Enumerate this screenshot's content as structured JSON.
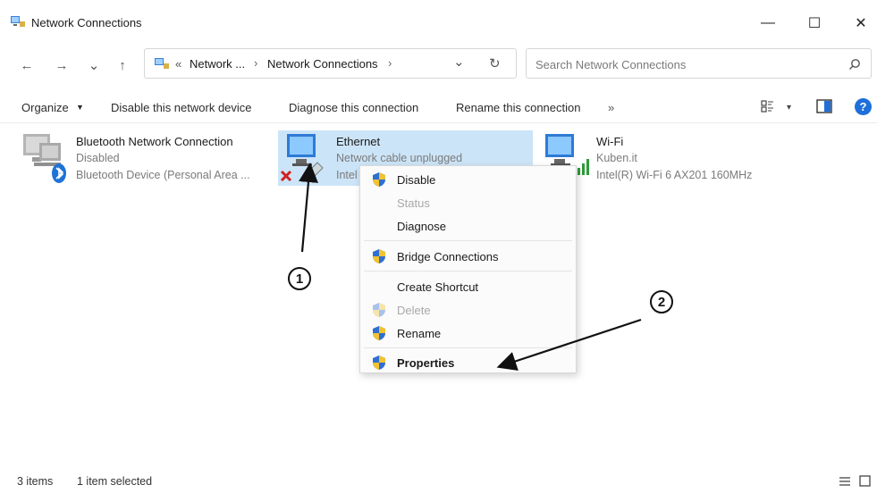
{
  "window": {
    "title": "Network Connections",
    "minimize": "—",
    "maximize": "☐",
    "close": "✕"
  },
  "nav": {
    "back": "←",
    "forward": "→",
    "recent": "⌄",
    "up": "↑",
    "breadcrumb_overflow": "«",
    "breadcrumb_1": "Network ...",
    "breadcrumb_sep": "›",
    "breadcrumb_2": "Network Connections",
    "breadcrumb_sep2": "›",
    "dropdown": "⌄",
    "refresh": "↻",
    "search_placeholder": "Search Network Connections"
  },
  "toolbar": {
    "organize": "Organize",
    "disable": "Disable this network device",
    "diagnose": "Diagnose this connection",
    "rename": "Rename this connection",
    "more": "»",
    "view_caret": "▾",
    "help": "?"
  },
  "connections": [
    {
      "name": "Bluetooth Network Connection",
      "status": "Disabled",
      "device": "Bluetooth Device (Personal Area ..."
    },
    {
      "name": "Ethernet",
      "status": "Network cable unplugged",
      "device": "Intel"
    },
    {
      "name": "Wi-Fi",
      "status": "Kuben.it",
      "device": "Intel(R) Wi-Fi 6 AX201 160MHz"
    }
  ],
  "context_menu": {
    "disable": "Disable",
    "status": "Status",
    "diagnose": "Diagnose",
    "bridge": "Bridge Connections",
    "shortcut": "Create Shortcut",
    "delete": "Delete",
    "rename": "Rename",
    "properties": "Properties"
  },
  "annotations": {
    "one": "1",
    "two": "2"
  },
  "statusbar": {
    "count": "3 items",
    "selected": "1 item selected"
  },
  "colors": {
    "selection": "#cce4f7",
    "accent": "#0067c0",
    "shield_blue": "#2f6fd1",
    "shield_yellow": "#f2c230"
  }
}
